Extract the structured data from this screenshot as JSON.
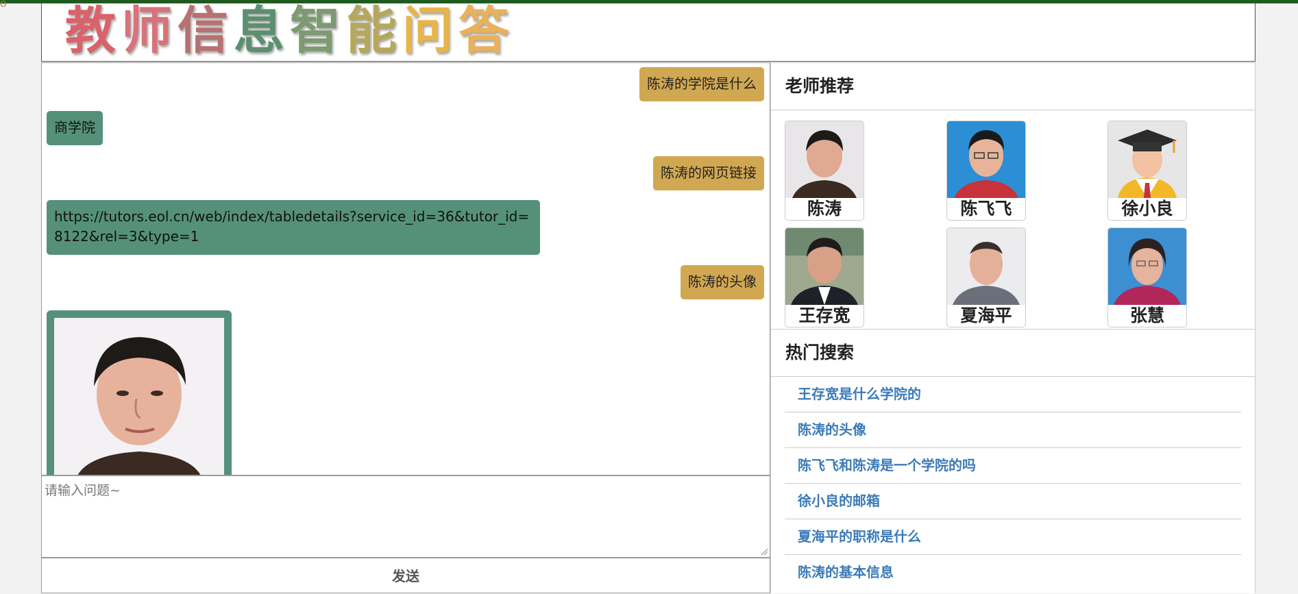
{
  "header": {
    "logo_chars": [
      {
        "ch": "教",
        "color": "#d9626b"
      },
      {
        "ch": "师",
        "color": "#d9727a"
      },
      {
        "ch": "信",
        "color": "#b87070"
      },
      {
        "ch": "息",
        "color": "#5c8f6f"
      },
      {
        "ch": "智",
        "color": "#7d9a70"
      },
      {
        "ch": "能",
        "color": "#b6a85b"
      },
      {
        "ch": "问",
        "color": "#e8b54a"
      },
      {
        "ch": "答",
        "color": "#e8b15a"
      }
    ]
  },
  "chat": {
    "messages": [
      {
        "role": "user",
        "text": "陈涛的学院是什么"
      },
      {
        "role": "bot",
        "text": "商学院"
      },
      {
        "role": "user",
        "text": "陈涛的网页链接"
      },
      {
        "role": "bot",
        "text": "https://tutors.eol.cn/web/index/tabledetails?service_id=36&tutor_id=8122&rel=3&type=1"
      },
      {
        "role": "user",
        "text": "陈涛的头像"
      },
      {
        "role": "bot",
        "type": "image",
        "image": "teacher-photo-chentao"
      }
    ]
  },
  "input": {
    "placeholder": "请输入问题~",
    "value": ""
  },
  "send_label": "发送",
  "recommend": {
    "title": "老师推荐",
    "teachers": [
      {
        "name": "陈涛",
        "bg": "#e9e6ea"
      },
      {
        "name": "陈飞飞",
        "bg": "#2c8ed4"
      },
      {
        "name": "徐小良",
        "bg": "#e6e6e6"
      },
      {
        "name": "王存宽",
        "bg": "#b9b9a8"
      },
      {
        "name": "夏海平",
        "bg": "#ecebee"
      },
      {
        "name": "张慧",
        "bg": "#3c8fd0"
      }
    ]
  },
  "hot": {
    "title": "热门搜索",
    "items": [
      "王存宽是什么学院的",
      "陈涛的头像",
      "陈飞飞和陈涛是一个学院的吗",
      "徐小良的邮箱",
      "夏海平的职称是什么",
      "陈涛的基本信息"
    ]
  }
}
